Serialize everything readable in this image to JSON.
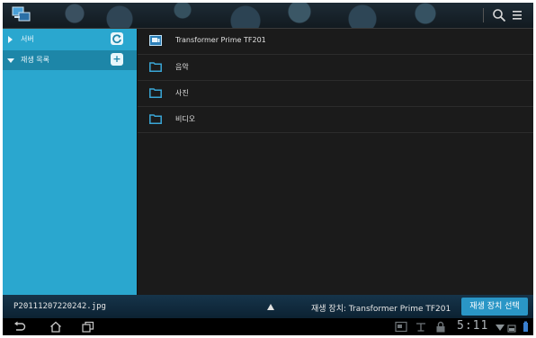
{
  "action_bar": {
    "app_icon": "dlna-app-icon",
    "search_icon": "search-icon",
    "menu_icon": "overflow-menu-icon"
  },
  "sidebar": {
    "items": [
      {
        "label": "서버",
        "expanded": false,
        "action_icon": "refresh-icon"
      },
      {
        "label": "재생 목록",
        "expanded": true,
        "action_icon": "add-icon",
        "action_glyph": "+"
      }
    ]
  },
  "main": {
    "rows": [
      {
        "label": "Transformer Prime TF201",
        "icon": "device-icon"
      },
      {
        "label": "음악",
        "icon": "folder-icon"
      },
      {
        "label": "사진",
        "icon": "folder-icon"
      },
      {
        "label": "비디오",
        "icon": "folder-icon"
      }
    ]
  },
  "player_bar": {
    "file_name": "P20111207220242.jpg",
    "device_text": "재생 장치: Transformer Prime TF201",
    "select_button": "재생 장치 선택"
  },
  "nav_bar": {
    "clock": "5:11",
    "icons": [
      "back-icon",
      "home-icon",
      "recent-apps-icon",
      "screenshot-icon",
      "usb-icon",
      "lock-icon",
      "wifi-icon",
      "battery-icon"
    ]
  },
  "colors": {
    "sidebar": "#2aa7cf",
    "accent": "#2a96c6",
    "list_bg": "#1b1b1b"
  }
}
